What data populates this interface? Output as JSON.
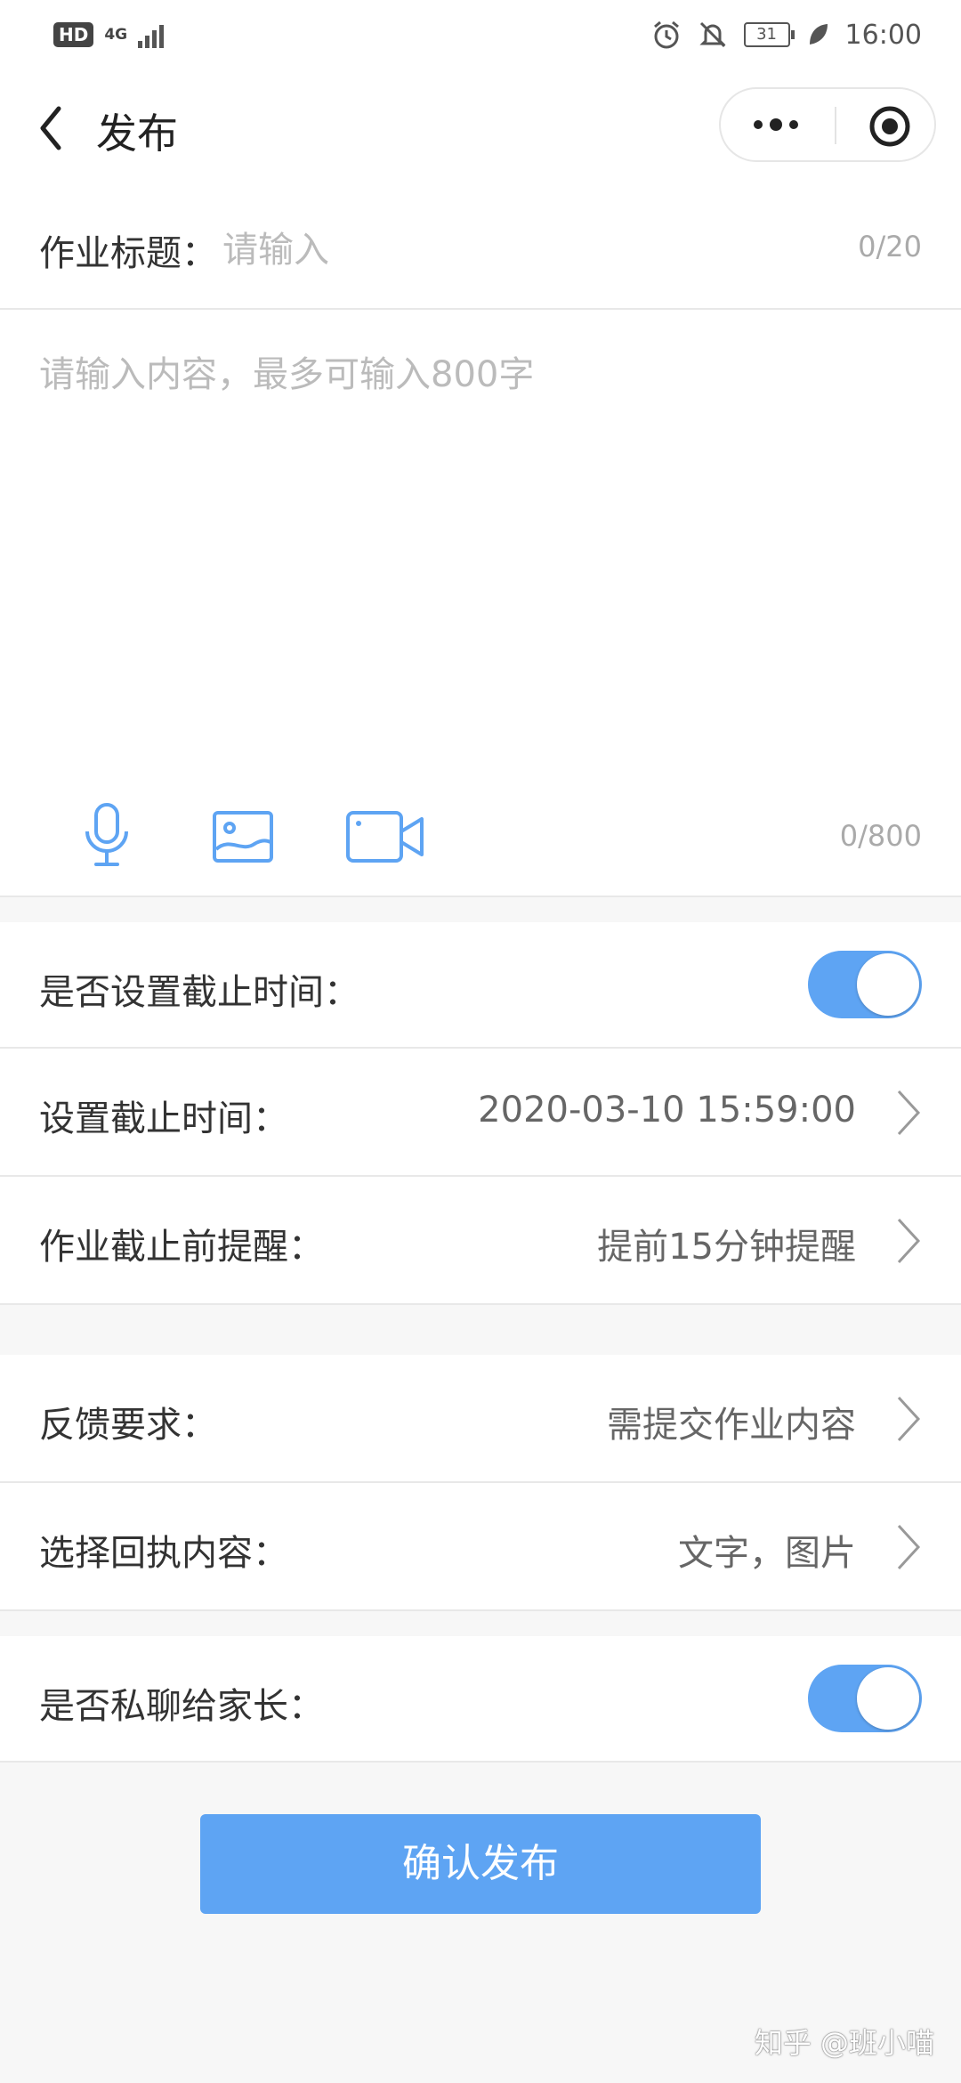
{
  "status_bar": {
    "hd_badge": "HD",
    "network": "4G",
    "battery": "31",
    "time": "16:00",
    "icons": [
      "alarm-icon",
      "mute-bell-icon",
      "battery-icon",
      "leaf-icon"
    ]
  },
  "nav": {
    "title": "发布",
    "back_icon": "chevron-left-icon",
    "more_icon": "more-dots-icon",
    "close_icon": "target-circle-icon"
  },
  "form": {
    "title_label": "作业标题：",
    "title_placeholder": "请输入",
    "title_count": "0/20",
    "content_placeholder": "请输入内容，最多可输入800字",
    "content_count": "0/800",
    "media_icons": [
      "microphone-icon",
      "image-icon",
      "video-camera-icon"
    ],
    "deadline_toggle_label": "是否设置截止时间：",
    "deadline_toggle_on": true,
    "deadline_label": "设置截止时间：",
    "deadline_value": "2020-03-10 15:59:00",
    "reminder_label": "作业截止前提醒：",
    "reminder_value": "提前15分钟提醒",
    "feedback_label": "反馈要求：",
    "feedback_value": "需提交作业内容",
    "receipt_label": "选择回执内容：",
    "receipt_value": "文字，图片",
    "private_toggle_label": "是否私聊给家长：",
    "private_toggle_on": true
  },
  "confirm_button": "确认发布",
  "watermark": "知乎 @班小喵",
  "colors": {
    "accent": "#5ea4f3",
    "background": "#f7f7f7",
    "placeholder": "#bbbbbb"
  }
}
